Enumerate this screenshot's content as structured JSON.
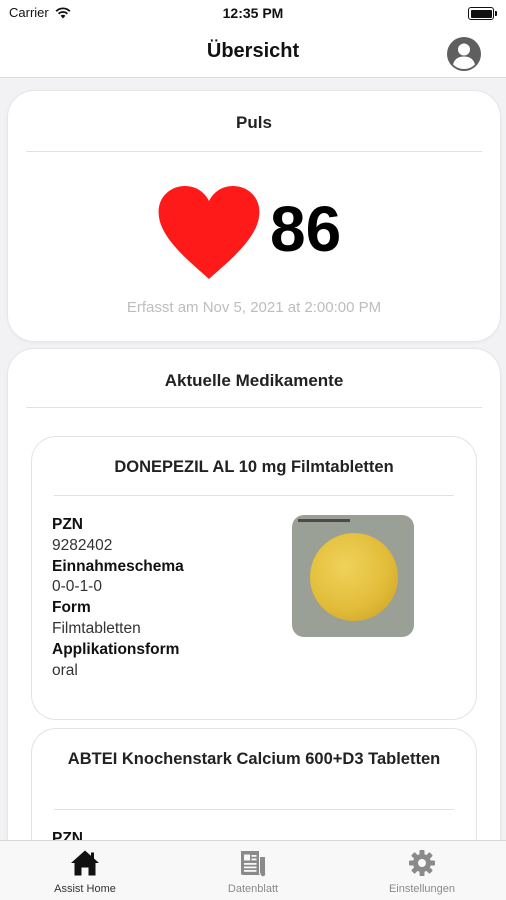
{
  "status_bar": {
    "carrier": "Carrier",
    "time": "12:35 PM"
  },
  "nav": {
    "title": "Übersicht"
  },
  "pulse": {
    "title": "Puls",
    "value": "86",
    "recorded": "Erfasst am Nov 5, 2021 at 2:00:00 PM"
  },
  "medications": {
    "title": "Aktuelle Medikamente",
    "items": [
      {
        "name": "DONEPEZIL AL 10 mg Filmtabletten",
        "pzn_label": "PZN",
        "pzn": "9282402",
        "schedule_label": "Einnahmeschema",
        "schedule": "0-0-1-0",
        "form_label": "Form",
        "form": "Filmtabletten",
        "application_label": "Applikationsform",
        "application": "oral"
      },
      {
        "name": "ABTEI Knochenstark Calcium 600+D3 Tabletten",
        "pzn_label": "PZN"
      }
    ]
  },
  "tabs": [
    {
      "label": "Assist Home",
      "icon": "home-icon",
      "active": true
    },
    {
      "label": "Datenblatt",
      "icon": "document-icon",
      "active": false
    },
    {
      "label": "Einstellungen",
      "icon": "gear-icon",
      "active": false
    }
  ],
  "colors": {
    "heart": "#ff1a1a",
    "pill": "#e2bd3a",
    "accent": "#000000"
  }
}
